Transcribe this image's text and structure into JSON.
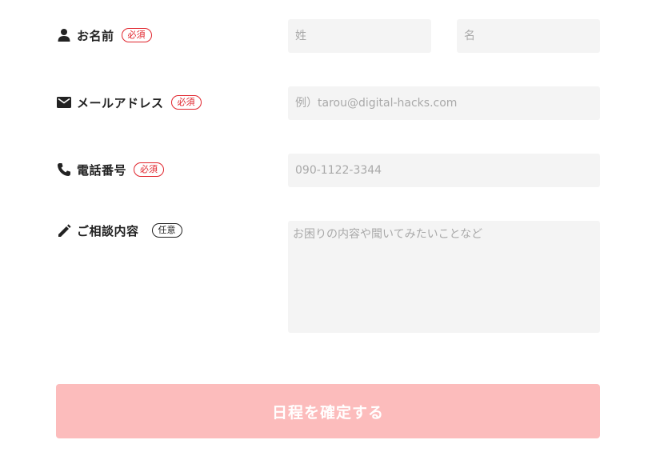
{
  "form": {
    "name": {
      "label": "お名前",
      "badge": "必須",
      "icon": "person-icon",
      "last_placeholder": "姓",
      "first_placeholder": "名"
    },
    "email": {
      "label": "メールアドレス",
      "badge": "必須",
      "icon": "envelope-icon",
      "placeholder": "例）tarou@digital-hacks.com"
    },
    "phone": {
      "label": "電話番号",
      "badge": "必須",
      "icon": "phone-icon",
      "placeholder": "090-1122-3344"
    },
    "consult": {
      "label": "ご相談内容",
      "badge": "任意",
      "icon": "pencil-icon",
      "placeholder": "お困りの内容や聞いてみたいことなど"
    },
    "submit_label": "日程を確定する"
  },
  "colors": {
    "required_badge": "#e0242c",
    "field_background": "#f4f4f4",
    "submit_background": "#fcbcbc"
  }
}
